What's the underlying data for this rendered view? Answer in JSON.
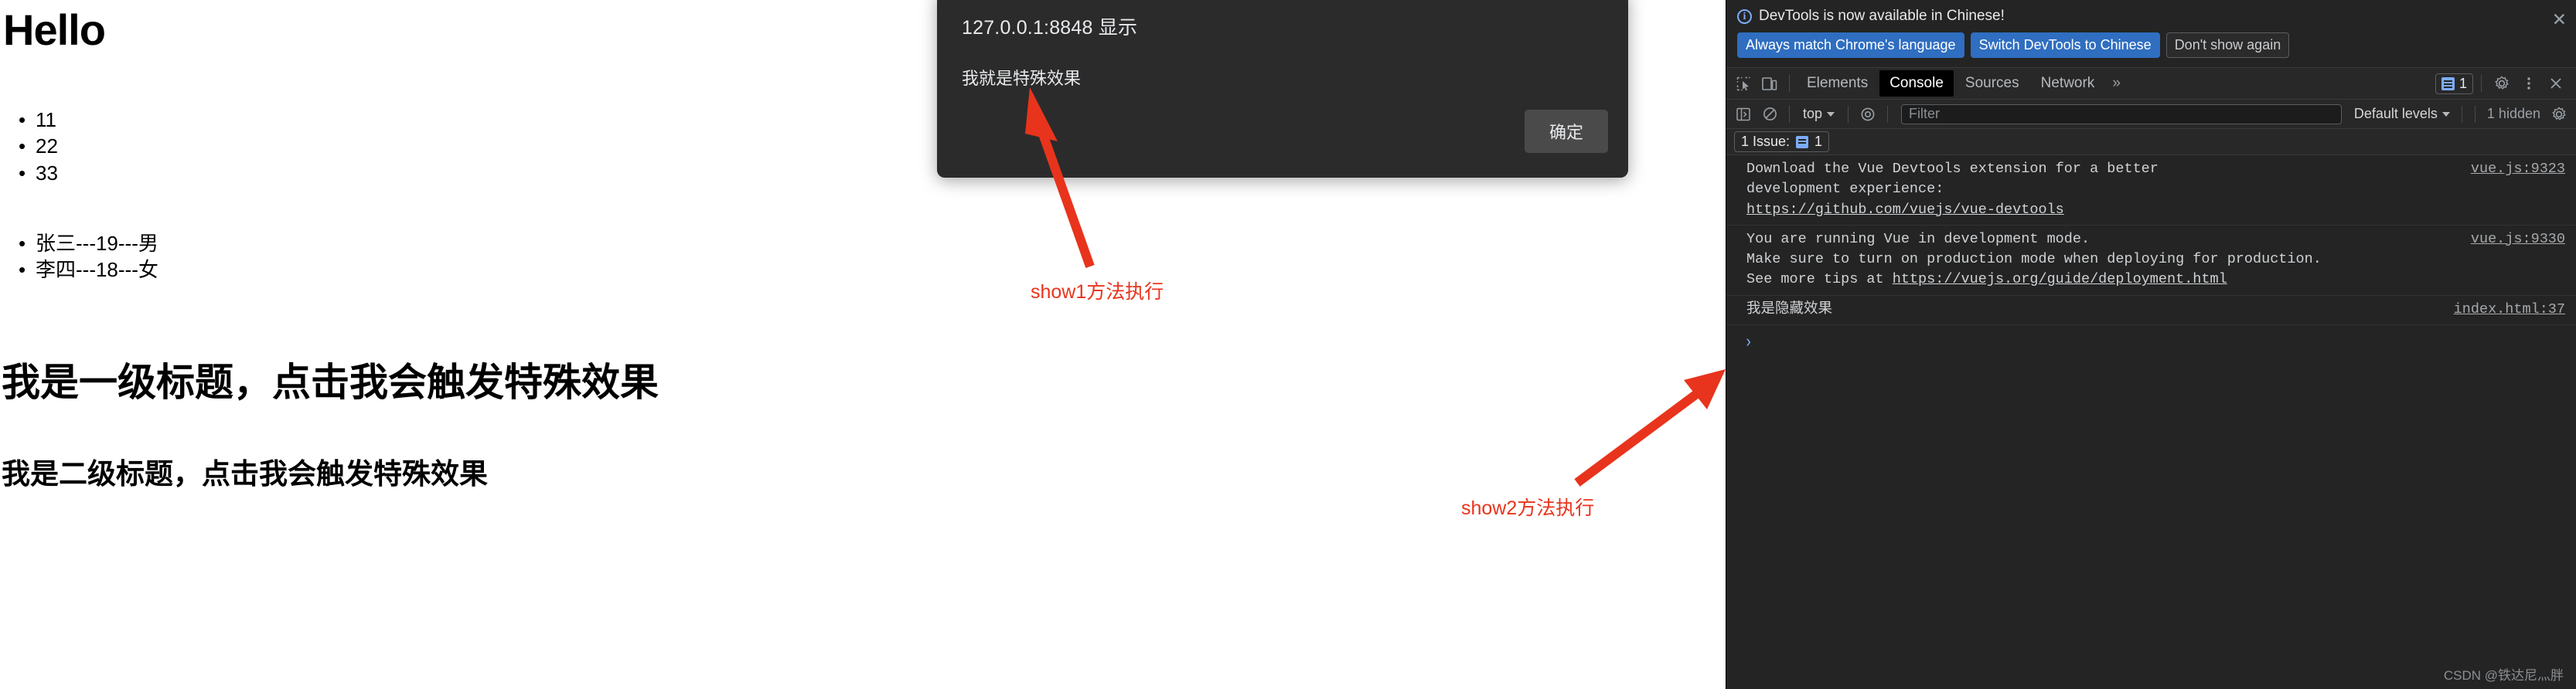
{
  "webpage": {
    "heading_hello": "Hello",
    "list_numbers": [
      "11",
      "22",
      "33"
    ],
    "list_people": [
      "张三---19---男",
      "李四---18---女"
    ],
    "heading_level1": "我是一级标题，点击我会触发特殊效果",
    "heading_level2": "我是二级标题，点击我会触发特殊效果"
  },
  "alert_dialog": {
    "origin": "127.0.0.1:8848 显示",
    "message": "我就是特殊效果",
    "ok_label": "确定"
  },
  "annotations": {
    "show1": "show1方法执行",
    "show2": "show2方法执行",
    "arrow_color": "#e8341c"
  },
  "devtools": {
    "banner": {
      "text": "DevTools is now available in Chinese!",
      "buttons": [
        {
          "label": "Always match Chrome's language",
          "style": "primary"
        },
        {
          "label": "Switch DevTools to Chinese",
          "style": "primary"
        },
        {
          "label": "Don't show again",
          "style": "secondary"
        }
      ],
      "close_label": "✕"
    },
    "tabs": [
      {
        "label": "Elements",
        "active": false
      },
      {
        "label": "Console",
        "active": true
      },
      {
        "label": "Sources",
        "active": false
      },
      {
        "label": "Network",
        "active": false
      }
    ],
    "tabs_more_label": "»",
    "issues_badge_count": "1",
    "console_toolbar": {
      "context": "top",
      "filter_placeholder": "Filter",
      "filter_value": "",
      "levels": "Default levels",
      "hidden_count": "1 hidden"
    },
    "issues_strip": {
      "label": "1 Issue:",
      "count": "1"
    },
    "console_messages": [
      {
        "lines": [
          "Download the Vue Devtools extension for a better",
          "development experience:"
        ],
        "link": "https://github.com/vuejs/vue-devtools",
        "source": "vue.js:9323"
      },
      {
        "lines": [
          "You are running Vue in development mode.",
          "Make sure to turn on production mode when deploying for production."
        ],
        "prefix_line3": "See more tips at ",
        "link": "https://vuejs.org/guide/deployment.html",
        "source": "vue.js:9330"
      },
      {
        "lines": [
          "我是隐藏效果"
        ],
        "source": "index.html:37"
      }
    ],
    "prompt_symbol": "›",
    "watermark": "CSDN @铁达尼灬胖"
  }
}
